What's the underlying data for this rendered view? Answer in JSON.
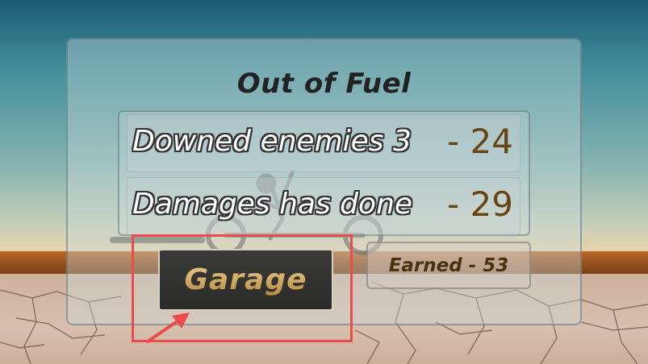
{
  "dialog": {
    "title": "Out of Fuel",
    "stats": [
      {
        "label": "Downed enemies 3",
        "value": "- 24"
      },
      {
        "label": "Damages has done",
        "value": "- 29"
      }
    ],
    "garage_label": "Garage",
    "earned_label": "Earned - 53"
  },
  "colors": {
    "highlight": "#ec4b4b",
    "value_text": "#6a4513",
    "garage_text": "#c9a25a"
  },
  "icons": {
    "annotation": "pointer-arrow-icon",
    "background": "stickman-rider-icon"
  }
}
